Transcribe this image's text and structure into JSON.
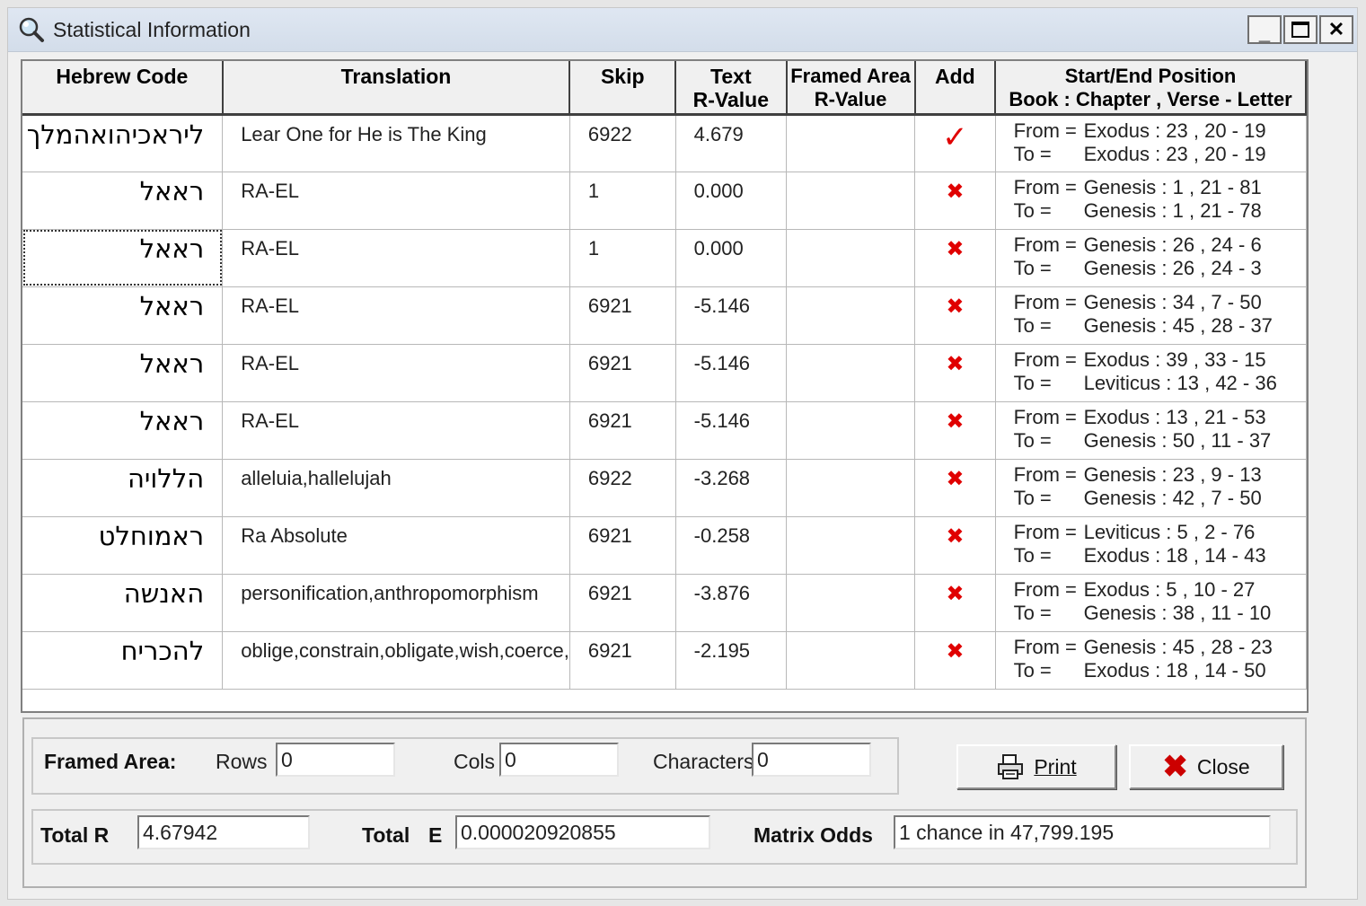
{
  "window": {
    "title": "Statistical Information",
    "minimize_glyph": "_",
    "close_glyph": "✕"
  },
  "table": {
    "headers": {
      "hebrew_code": "Hebrew Code",
      "translation": "Translation",
      "skip": "Skip",
      "text_r_line1": "Text",
      "text_r_line2": "R-Value",
      "framed_line1": "Framed Area",
      "framed_line2": "R-Value",
      "add": "Add",
      "pos_line1": "Start/End Position",
      "pos_line2": "Book : Chapter , Verse - Letter"
    },
    "from_label": "From =",
    "to_label": "To =",
    "rows": [
      {
        "hebrew": "ליראכיהואהמלך",
        "translation": "Lear One for He is The King",
        "skip": "6922",
        "text_r": "4.679",
        "framed_r": "",
        "added": true,
        "add_glyph": "✓",
        "from": "Exodus : 23 , 20 - 19",
        "to": "Exodus : 23 , 20 - 19"
      },
      {
        "hebrew": "ראאל",
        "translation": "RA-EL",
        "skip": "1",
        "text_r": "0.000",
        "framed_r": "",
        "added": false,
        "add_glyph": "✖",
        "from": "Genesis : 1 , 21 - 81",
        "to": "Genesis : 1 , 21 - 78"
      },
      {
        "hebrew": "ראאל",
        "translation": "RA-EL",
        "skip": "1",
        "text_r": "0.000",
        "framed_r": "",
        "added": false,
        "add_glyph": "✖",
        "from": "Genesis : 26 , 24 - 6",
        "to": "Genesis : 26 , 24 - 3"
      },
      {
        "hebrew": "ראאל",
        "translation": "RA-EL",
        "skip": "6921",
        "text_r": "-5.146",
        "framed_r": "",
        "added": false,
        "add_glyph": "✖",
        "from": "Genesis : 34 , 7 - 50",
        "to": "Genesis : 45 , 28 - 37"
      },
      {
        "hebrew": "ראאל",
        "translation": "RA-EL",
        "skip": "6921",
        "text_r": "-5.146",
        "framed_r": "",
        "added": false,
        "add_glyph": "✖",
        "from": "Exodus : 39 , 33 - 15",
        "to": "Leviticus : 13 , 42 - 36"
      },
      {
        "hebrew": "ראאל",
        "translation": "RA-EL",
        "skip": "6921",
        "text_r": "-5.146",
        "framed_r": "",
        "added": false,
        "add_glyph": "✖",
        "from": "Exodus : 13 , 21 - 53",
        "to": "Genesis : 50 , 11 - 37"
      },
      {
        "hebrew": "הללויה",
        "translation": "alleluia,hallelujah",
        "skip": "6922",
        "text_r": "-3.268",
        "framed_r": "",
        "added": false,
        "add_glyph": "✖",
        "from": "Genesis : 23 , 9 - 13",
        "to": "Genesis : 42 , 7 - 50"
      },
      {
        "hebrew": "ראמוחלט",
        "translation": "Ra Absolute",
        "skip": "6921",
        "text_r": "-0.258",
        "framed_r": "",
        "added": false,
        "add_glyph": "✖",
        "from": "Leviticus : 5 , 2 - 76",
        "to": "Exodus : 18 , 14 - 43"
      },
      {
        "hebrew": "האנשה",
        "translation": "personification,anthropomorphism",
        "skip": "6921",
        "text_r": "-3.876",
        "framed_r": "",
        "added": false,
        "add_glyph": "✖",
        "from": "Exodus : 5 , 10 - 27",
        "to": "Genesis : 38 , 11 - 10"
      },
      {
        "hebrew": "להכריח",
        "translation": "oblige,constrain,obligate,wish,coerce,",
        "skip": "6921",
        "text_r": "-2.195",
        "framed_r": "",
        "added": false,
        "add_glyph": "✖",
        "from": "Genesis : 45 , 28 - 23",
        "to": "Exodus : 18 , 14 - 50"
      }
    ]
  },
  "framed_area": {
    "label": "Framed Area:",
    "rows_label": "Rows",
    "rows_value": "0",
    "cols_label": "Cols",
    "cols_value": "0",
    "chars_label": "Characters",
    "chars_value": "0"
  },
  "buttons": {
    "print": "Print",
    "close": "Close"
  },
  "totals": {
    "total_r_label": "Total R",
    "total_r_value": "4.67942",
    "total_e_label": "Total",
    "total_e_letter": "E",
    "total_e_value": "0.000020920855",
    "matrix_odds_label": "Matrix Odds",
    "matrix_odds_value": "1 chance in 47,799.195"
  },
  "colors": {
    "check": "#e00000",
    "cross": "#e00000",
    "close_icon": "#cc0000"
  }
}
